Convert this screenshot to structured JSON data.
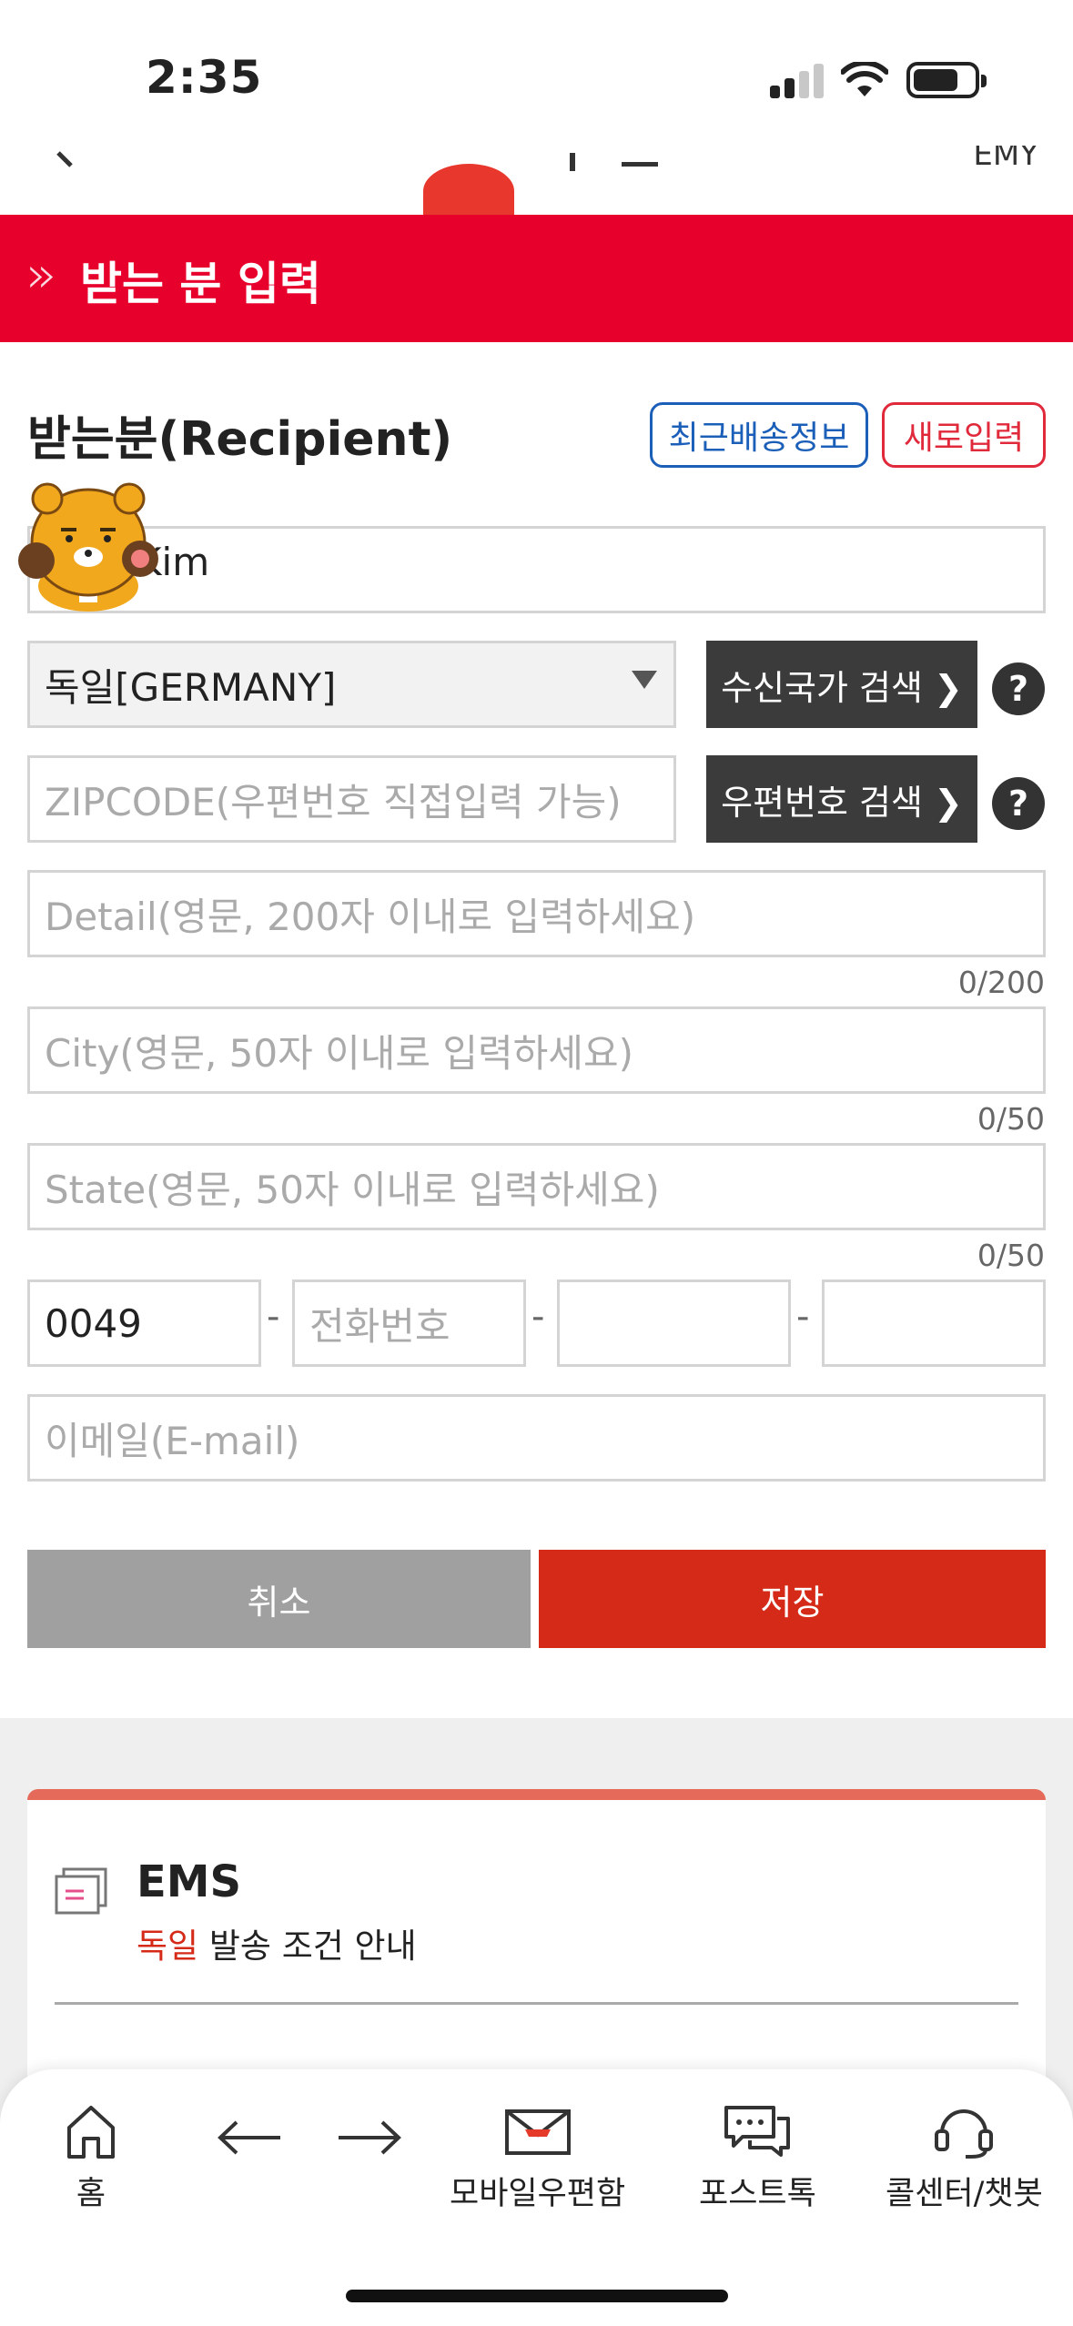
{
  "status_bar": {
    "time": "2:35"
  },
  "top_header": {
    "fragment_right": "EMY"
  },
  "section": {
    "title": "받는 분 입력",
    "chevron": "»"
  },
  "recipient": {
    "heading": "받는분(Recipient)",
    "recent_button": "최근배송정보",
    "new_button": "새로입력",
    "name_value": "Kim",
    "country_value": "독일[GERMANY]",
    "country_search_button": "수신국가 검색 ❯",
    "zipcode_placeholder": "ZIPCODE(우편번호 직접입력 가능)",
    "zipcode_search_button": "우편번호 검색 ❯",
    "help_label": "?",
    "detail_placeholder": "Detail(영문, 200자 이내로 입력하세요)",
    "detail_counter": "0/200",
    "city_placeholder": "City(영문, 50자 이내로 입력하세요)",
    "city_counter": "0/50",
    "state_placeholder": "State(영문, 50자 이내로 입력하세요)",
    "state_counter": "0/50",
    "phone_country_code": "0049",
    "phone_placeholder": "전화번호",
    "phone_dash": "-",
    "email_placeholder": "이메일(E-mail)"
  },
  "actions": {
    "cancel": "취소",
    "save": "저장"
  },
  "ems": {
    "title": "EMS",
    "country": "독일",
    "subtitle_rest": " 발송 조건 안내"
  },
  "bottom_nav": {
    "home": "홈",
    "mailbox": "모바일우편함",
    "posttalk": "포스트톡",
    "callcenter": "콜센터/챗봇"
  },
  "colors": {
    "brand_red": "#e8002d",
    "save_red": "#d52a18",
    "link_blue": "#1b5fb8"
  }
}
